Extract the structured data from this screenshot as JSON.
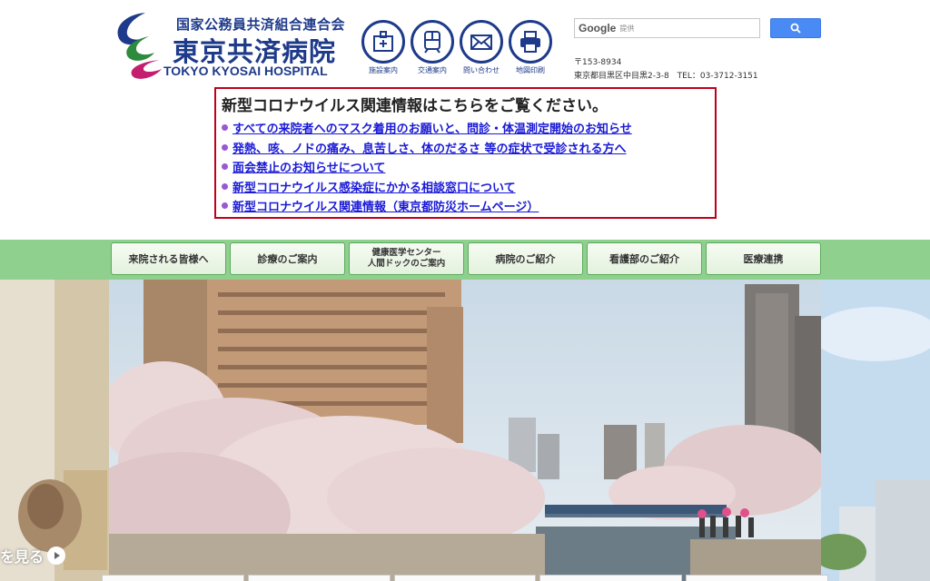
{
  "header": {
    "org_line": "国家公務員共済組合連合会",
    "hospital_name_ja": "東京共済病院",
    "hospital_name_en": "TOKYO KYOSAI HOSPITAL"
  },
  "icon_links": [
    {
      "label": "施設案内",
      "icon": "building-icon"
    },
    {
      "label": "交通案内",
      "icon": "train-icon"
    },
    {
      "label": "問い合わせ",
      "icon": "mail-icon"
    },
    {
      "label": "地図印刷",
      "icon": "printer-icon"
    }
  ],
  "search": {
    "brand": "Google",
    "placeholder": "提供"
  },
  "address": {
    "postal": "〒153-8934",
    "line": "東京都目黒区中目黒2-3-8　TEL：03-3712-3151"
  },
  "notice": {
    "title": "新型コロナウイルス関連情報はこちらをご覧ください。",
    "links": [
      "すべての来院者へのマスク着用のお願いと、問診・体温測定開始のお知らせ",
      "発熱、咳、ノドの痛み、息苦しさ、体のだるさ 等の症状で受診される方へ",
      "面会禁止のお知らせについて",
      "新型コロナウイルス感染症にかかる相談窓口について",
      "新型コロナウイルス関連情報（東京都防災ホームページ）"
    ]
  },
  "nav": [
    "来院される皆様へ",
    "診療のご案内",
    "健康医学センター\n人間ドックのご案内",
    "病院のご紹介",
    "看護部のご紹介",
    "医療連携"
  ],
  "hero": {
    "see_more": "を見る"
  },
  "colors": {
    "brand_blue": "#1e3a8a",
    "notice_border": "#c0001a",
    "nav_green": "#8fd08f",
    "link_blue": "#1a1ad6"
  }
}
